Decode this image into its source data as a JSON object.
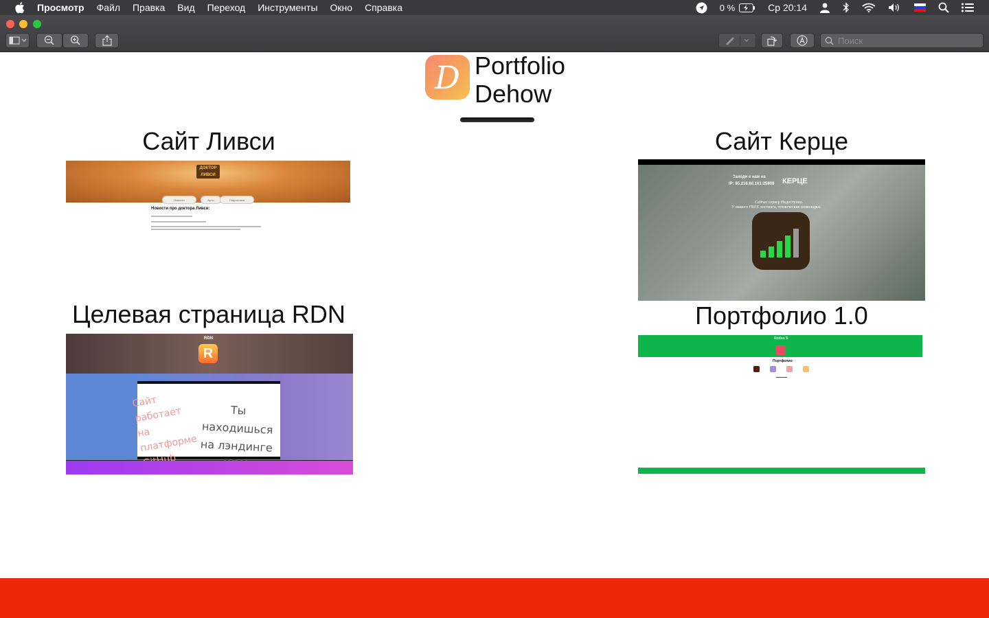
{
  "menubar": {
    "app": "Просмотр",
    "items": [
      "Файл",
      "Правка",
      "Вид",
      "Переход",
      "Инструменты",
      "Окно",
      "Справка"
    ],
    "battery": "0 %",
    "clock": "Ср 20:14"
  },
  "toolbar": {
    "search_placeholder": "Поиск"
  },
  "header": {
    "logo_letter": "D",
    "title_line1": "Portfolio",
    "title_line2": "Dehow"
  },
  "projects": [
    {
      "title": "Сайт Ливси",
      "heading": "Новости про доктора Ливси:",
      "logo_text": "ДОКТОР ЛИВСИ",
      "nav": [
        "Новости",
        "Арты",
        "Подписчики"
      ]
    },
    {
      "title": "Сайт Керце",
      "line1": "Заходи к нам на",
      "brand": "КЕРЦЕ",
      "ip": "IP: 95.216.68.161:25909",
      "status": "Сейчас сервер Недоступен.",
      "note": "У нашего FREE хостинга, технические шоколадки."
    },
    {
      "title": "Целевая страница RDN",
      "name": "RDN",
      "icon_letter": "R",
      "video_text_left": "Сайт работает на платформе GitHub Pages",
      "video_text_right": "Ты находишься на лэндинге RDN"
    },
    {
      "title": "Портфолио 1.0",
      "name": "Dodoo 5",
      "section": "Портфолио"
    }
  ],
  "colors": {
    "footer": "#ee2708",
    "logo_gradient_start": "#f58a72",
    "logo_gradient_end": "#f6c253",
    "green": "#0db54a"
  }
}
